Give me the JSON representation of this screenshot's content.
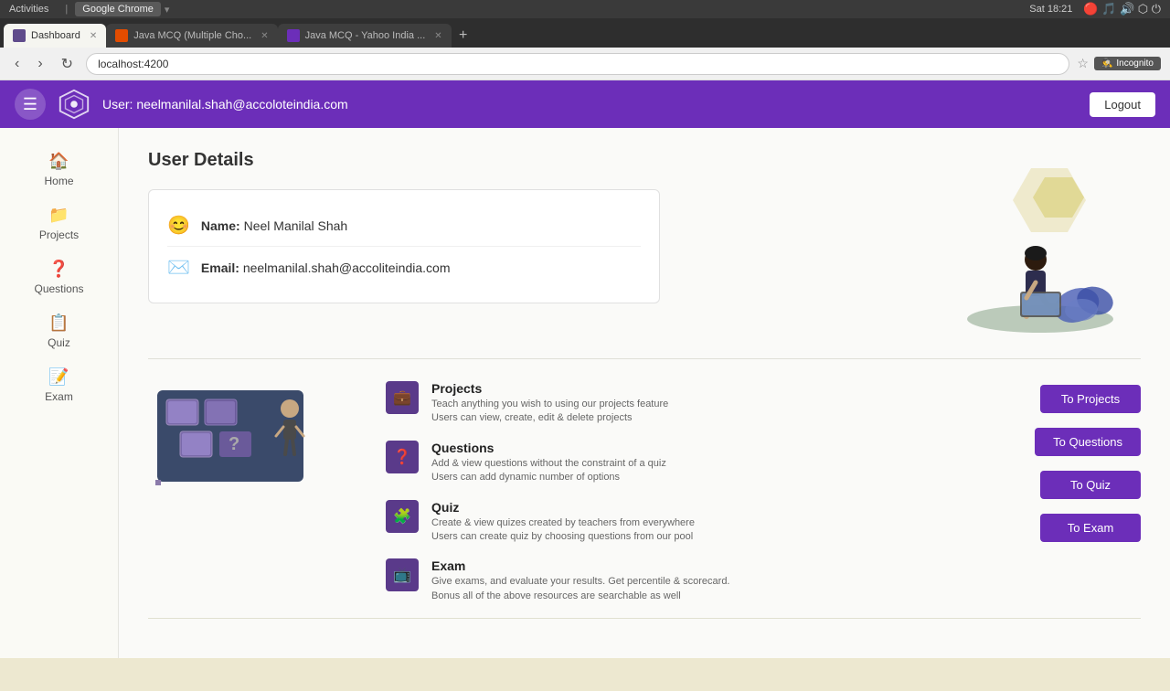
{
  "browser": {
    "titlebar": {
      "activities": "Activities",
      "chrome_label": "Google Chrome"
    },
    "tabs": [
      {
        "id": "dashboard",
        "label": "Dashboard",
        "active": true,
        "favicon_color": "#5f4b8b"
      },
      {
        "id": "java-mcq-1",
        "label": "Java MCQ (Multiple Cho...",
        "active": false,
        "favicon_color": "#e34c00"
      },
      {
        "id": "java-mcq-2",
        "label": "Java MCQ - Yahoo India ...",
        "active": false,
        "favicon_color": "#6c2eb9"
      }
    ],
    "address": "localhost:4200",
    "datetime": "Sat 18:21",
    "incognito_label": "Incognito"
  },
  "navbar": {
    "user_label": "User: neelmanilal.shah@accoloteindia.com",
    "user_email": "neelmanilal.shah@accoliteindia.com",
    "logout_label": "Logout"
  },
  "sidebar": {
    "items": [
      {
        "id": "home",
        "label": "Home",
        "icon": "🏠"
      },
      {
        "id": "projects",
        "label": "Projects",
        "icon": "📁"
      },
      {
        "id": "questions",
        "label": "Questions",
        "icon": "❓"
      },
      {
        "id": "quiz",
        "label": "Quiz",
        "icon": "📋"
      },
      {
        "id": "exam",
        "label": "Exam",
        "icon": "📝"
      }
    ]
  },
  "page": {
    "title": "User Details",
    "user_name_label": "Name:",
    "user_name_value": "Neel Manilal Shah",
    "user_email_label": "Email:",
    "user_email_value": "neelmanilal.shah@accoliteindia.com"
  },
  "features": [
    {
      "id": "projects",
      "title": "Projects",
      "desc_line1": "Teach anything you wish to using our projects feature",
      "desc_line2": "Users can view, create, edit & delete projects",
      "btn_label": "To Projects",
      "icon": "💼"
    },
    {
      "id": "questions",
      "title": "Questions",
      "desc_line1": "Add & view questions without the constraint of a quiz",
      "desc_line2": "Users can add dynamic number of options",
      "btn_label": "To Questions",
      "icon": "❓"
    },
    {
      "id": "quiz",
      "title": "Quiz",
      "desc_line1": "Create & view quizes created by teachers from everywhere",
      "desc_line2": "Users can create quiz by choosing questions from our pool",
      "btn_label": "To Quiz",
      "icon": "🧩"
    },
    {
      "id": "exam",
      "title": "Exam",
      "desc_line1": "Give exams, and evaluate your results. Get percentile & scorecard.",
      "desc_line2": "Bonus all of the above resources are searchable as well",
      "btn_label": "To Exam",
      "icon": "📺"
    }
  ]
}
